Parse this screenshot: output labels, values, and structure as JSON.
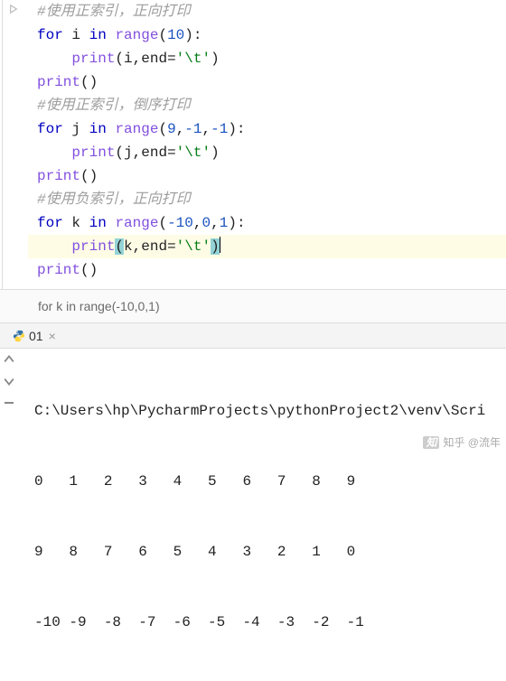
{
  "editor": {
    "c1": "#使用正索引，正向打印",
    "l2": {
      "for": "for",
      "var": "i",
      "in": "in",
      "range": "range",
      "open": "(",
      "n": "10",
      "close": ")",
      "colon": ":"
    },
    "l3": {
      "print": "print",
      "open": "(",
      "arg": "i",
      "comma": ",",
      "kw": "end",
      "eq": "=",
      "str": "'\\t'",
      "close": ")"
    },
    "l4": {
      "print": "print",
      "open": "(",
      "close": ")"
    },
    "c2": "#使用正索引，倒序打印",
    "l6": {
      "for": "for",
      "var": "j",
      "in": "in",
      "range": "range",
      "open": "(",
      "a": "9",
      "c1": ",",
      "b": "-1",
      "c2": ",",
      "c": "-1",
      "close": ")",
      "colon": ":"
    },
    "l7": {
      "print": "print",
      "open": "(",
      "arg": "j",
      "comma": ",",
      "kw": "end",
      "eq": "=",
      "str": "'\\t'",
      "close": ")"
    },
    "l8": {
      "print": "print",
      "open": "(",
      "close": ")"
    },
    "c3": "#使用负索引，正向打印",
    "l10": {
      "for": "for",
      "var": "k",
      "in": "in",
      "range": "range",
      "open": "(",
      "a": "-10",
      "c1": ",",
      "b": "0",
      "c2": ",",
      "c": "1",
      "close": ")",
      "colon": ":"
    },
    "l11": {
      "print": "print",
      "open": "(",
      "arg": "k",
      "comma": ",",
      "kw": "end",
      "eq": "=",
      "str": "'\\t'",
      "close": ")"
    },
    "l12": {
      "print": "print",
      "open": "(",
      "close": ")"
    }
  },
  "breadcrumb": "for k in range(-10,0,1)",
  "run_tab": {
    "name": "01"
  },
  "console": {
    "path": "C:\\Users\\hp\\PycharmProjects\\pythonProject2\\venv\\Scri",
    "row1": "0   1   2   3   4   5   6   7   8   9   ",
    "row2": "9   8   7   6   5   4   3   2   1   0   ",
    "row3": "-10 -9  -8  -7  -6  -5  -4  -3  -2  -1  "
  },
  "watermark": "知乎 @流年",
  "chart_data": {
    "type": "table",
    "title": "Python range() iteration output",
    "series": [
      {
        "name": "range(10)",
        "values": [
          0,
          1,
          2,
          3,
          4,
          5,
          6,
          7,
          8,
          9
        ]
      },
      {
        "name": "range(9,-1,-1)",
        "values": [
          9,
          8,
          7,
          6,
          5,
          4,
          3,
          2,
          1,
          0
        ]
      },
      {
        "name": "range(-10,0,1)",
        "values": [
          -10,
          -9,
          -8,
          -7,
          -6,
          -5,
          -4,
          -3,
          -2,
          -1
        ]
      }
    ]
  }
}
